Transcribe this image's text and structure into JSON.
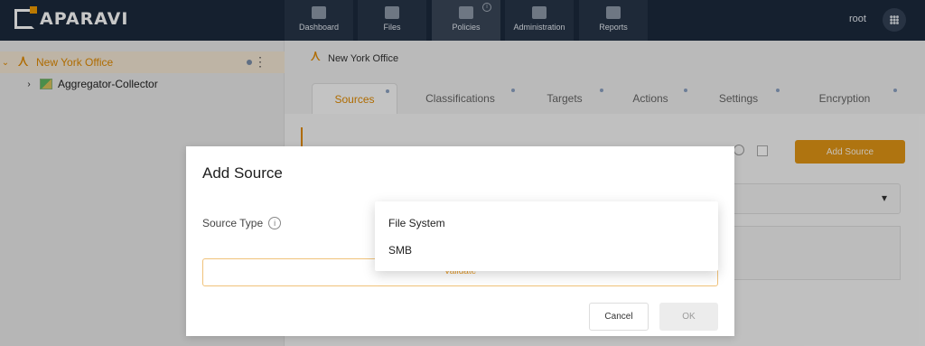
{
  "app": {
    "logo_text": "APARAVI",
    "user": "root"
  },
  "nav": {
    "tabs": [
      {
        "label": "Dashboard"
      },
      {
        "label": "Files"
      },
      {
        "label": "Policies"
      },
      {
        "label": "Administration"
      },
      {
        "label": "Reports"
      }
    ],
    "active": "Policies"
  },
  "sidebar": {
    "items": [
      {
        "label": "New York Office",
        "expanded": true,
        "selected": true
      },
      {
        "label": "Aggregator-Collector",
        "expanded": false
      }
    ]
  },
  "main": {
    "breadcrumb": "New York Office",
    "tabs": [
      {
        "label": "Sources"
      },
      {
        "label": "Classifications"
      },
      {
        "label": "Targets"
      },
      {
        "label": "Actions"
      },
      {
        "label": "Settings"
      },
      {
        "label": "Encryption"
      }
    ],
    "active_tab": "Sources",
    "add_source_label": "Add Source"
  },
  "modal": {
    "title": "Add Source",
    "source_type_label": "Source Type",
    "validate_label": "Validate",
    "cancel_label": "Cancel",
    "ok_label": "OK"
  },
  "dropdown": {
    "options": [
      "File System",
      "SMB"
    ]
  },
  "colors": {
    "accent": "#e08a00",
    "nav_bg": "#1c2a3d",
    "button_orange": "#e09515"
  }
}
